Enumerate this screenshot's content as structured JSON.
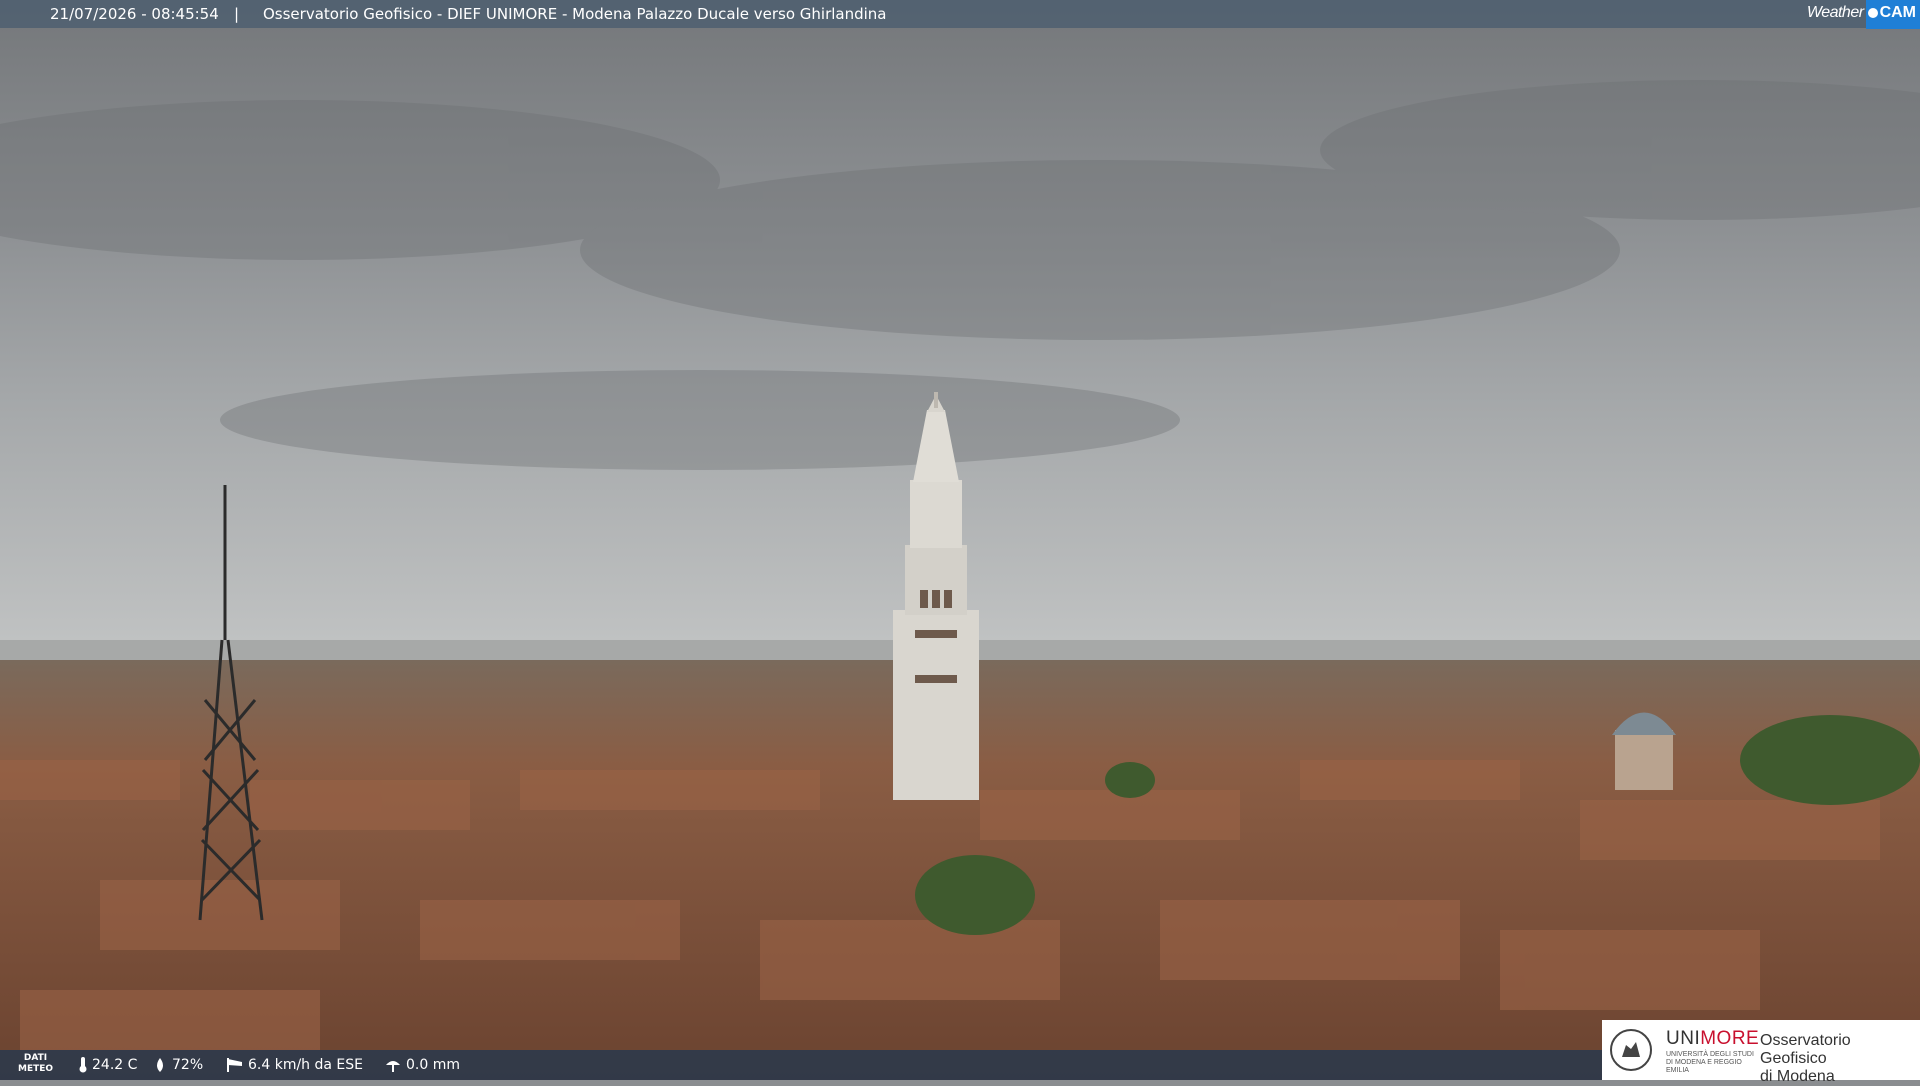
{
  "overlay": {
    "datetime": "21/07/2026 - 08:45:54",
    "separator": "|",
    "title": "Osservatorio Geofisico - DIEF UNIMORE - Modena Palazzo Ducale verso Ghirlandina"
  },
  "brand": {
    "weather": "Weather",
    "cam": "CAM"
  },
  "meteo": {
    "label_line1": "DATI",
    "label_line2": "METEO",
    "temperature": "24.2 C",
    "humidity": "72%",
    "wind": "6.4 km/h da ESE",
    "rain": "0.0 mm",
    "icons": [
      "thermometer-icon",
      "humidity-drop-icon",
      "wind-sock-icon",
      "rain-gauge-icon"
    ]
  },
  "logo": {
    "uni": "UNI",
    "more": "MORE",
    "subtitle": "UNIVERSITÀ DEGLI STUDI DI MODENA E REGGIO EMILIA",
    "observatory_line1": "Osservatorio Geofisico",
    "observatory_line2": "di Modena"
  },
  "colors": {
    "sky": "#8a8d90",
    "roofs": "#8a5a3e",
    "tower": "#d9d6cf",
    "brand_blue": "#1f7fd6",
    "unimore_red": "#c8102e"
  }
}
